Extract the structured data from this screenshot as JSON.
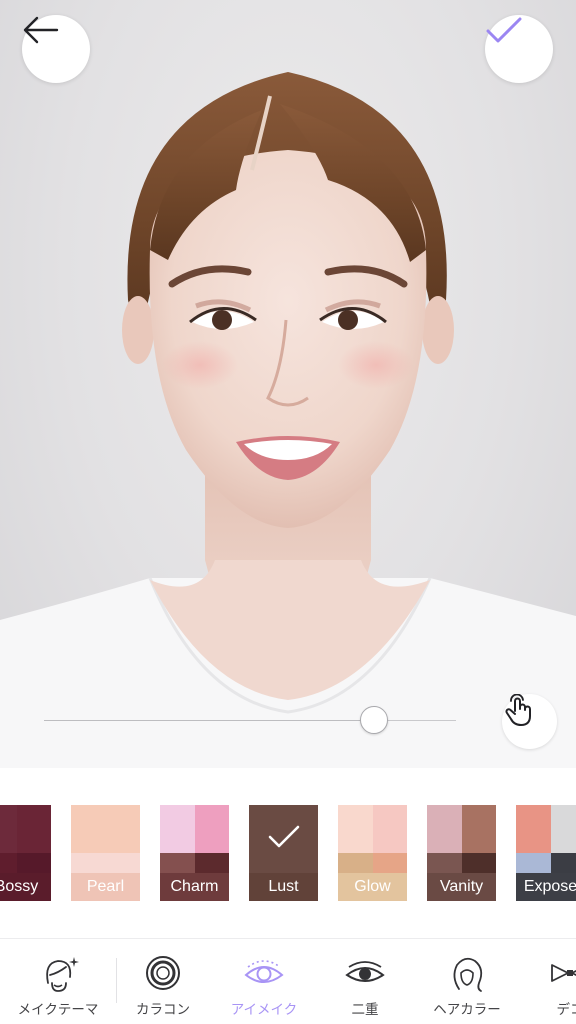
{
  "colors": {
    "accent": "#9b86f2",
    "active_tab": "#a894f5",
    "icon_dark": "#333336"
  },
  "header": {
    "back_icon": "arrow-left-icon",
    "confirm_icon": "checkmark-icon"
  },
  "intensity_slider": {
    "value": 0.8
  },
  "compare_button_icon": "hand-tap-icon",
  "palettes": [
    {
      "label": "Bossy",
      "selected": false,
      "colors": [
        "#6d2a3b",
        "#6a2536",
        "#5f1d2d",
        "#56192a"
      ],
      "label_bg": "#5a1c2b"
    },
    {
      "label": "Pearl",
      "selected": false,
      "colors": [
        "#f6cbb7",
        "#f6cbb7",
        "#f7d9d3",
        "#f7d9d3"
      ],
      "label_bg": "#efc4b6"
    },
    {
      "label": "Charm",
      "selected": false,
      "colors": [
        "#f2cbe3",
        "#ee9fbf",
        "#84504f",
        "#5c2a2d"
      ],
      "label_bg": "#6e3b3c"
    },
    {
      "label": "Lust",
      "selected": true,
      "colors": [
        "#6a4b43",
        "#6a4b43",
        "#6a4b43",
        "#6a4b43"
      ],
      "label_bg": "#614239"
    },
    {
      "label": "Glow",
      "selected": false,
      "colors": [
        "#f9d8cd",
        "#f6c8c2",
        "#d8b088",
        "#e6a587"
      ],
      "label_bg": "#e3c49e"
    },
    {
      "label": "Vanity",
      "selected": false,
      "colors": [
        "#dab0b7",
        "#a87262",
        "#7a5651",
        "#4e2f2a"
      ],
      "label_bg": "#6a4a44"
    },
    {
      "label": "Expose",
      "selected": false,
      "colors": [
        "#e89485",
        "#d9d9da",
        "#aab8d6",
        "#3b3d44"
      ],
      "label_bg": "#3d3f46"
    }
  ],
  "tabs": [
    {
      "label": "メイクテーマ",
      "icon": "face-sparkle-icon",
      "active": false
    },
    {
      "label": "カラコン",
      "icon": "contact-lens-icon",
      "active": false
    },
    {
      "label": "アイメイク",
      "icon": "eye-makeup-icon",
      "active": true
    },
    {
      "label": "二重",
      "icon": "double-eyelid-icon",
      "active": false
    },
    {
      "label": "ヘアカラー",
      "icon": "hair-color-icon",
      "active": false
    },
    {
      "label": "デコ",
      "icon": "ribbon-icon",
      "active": false
    }
  ]
}
